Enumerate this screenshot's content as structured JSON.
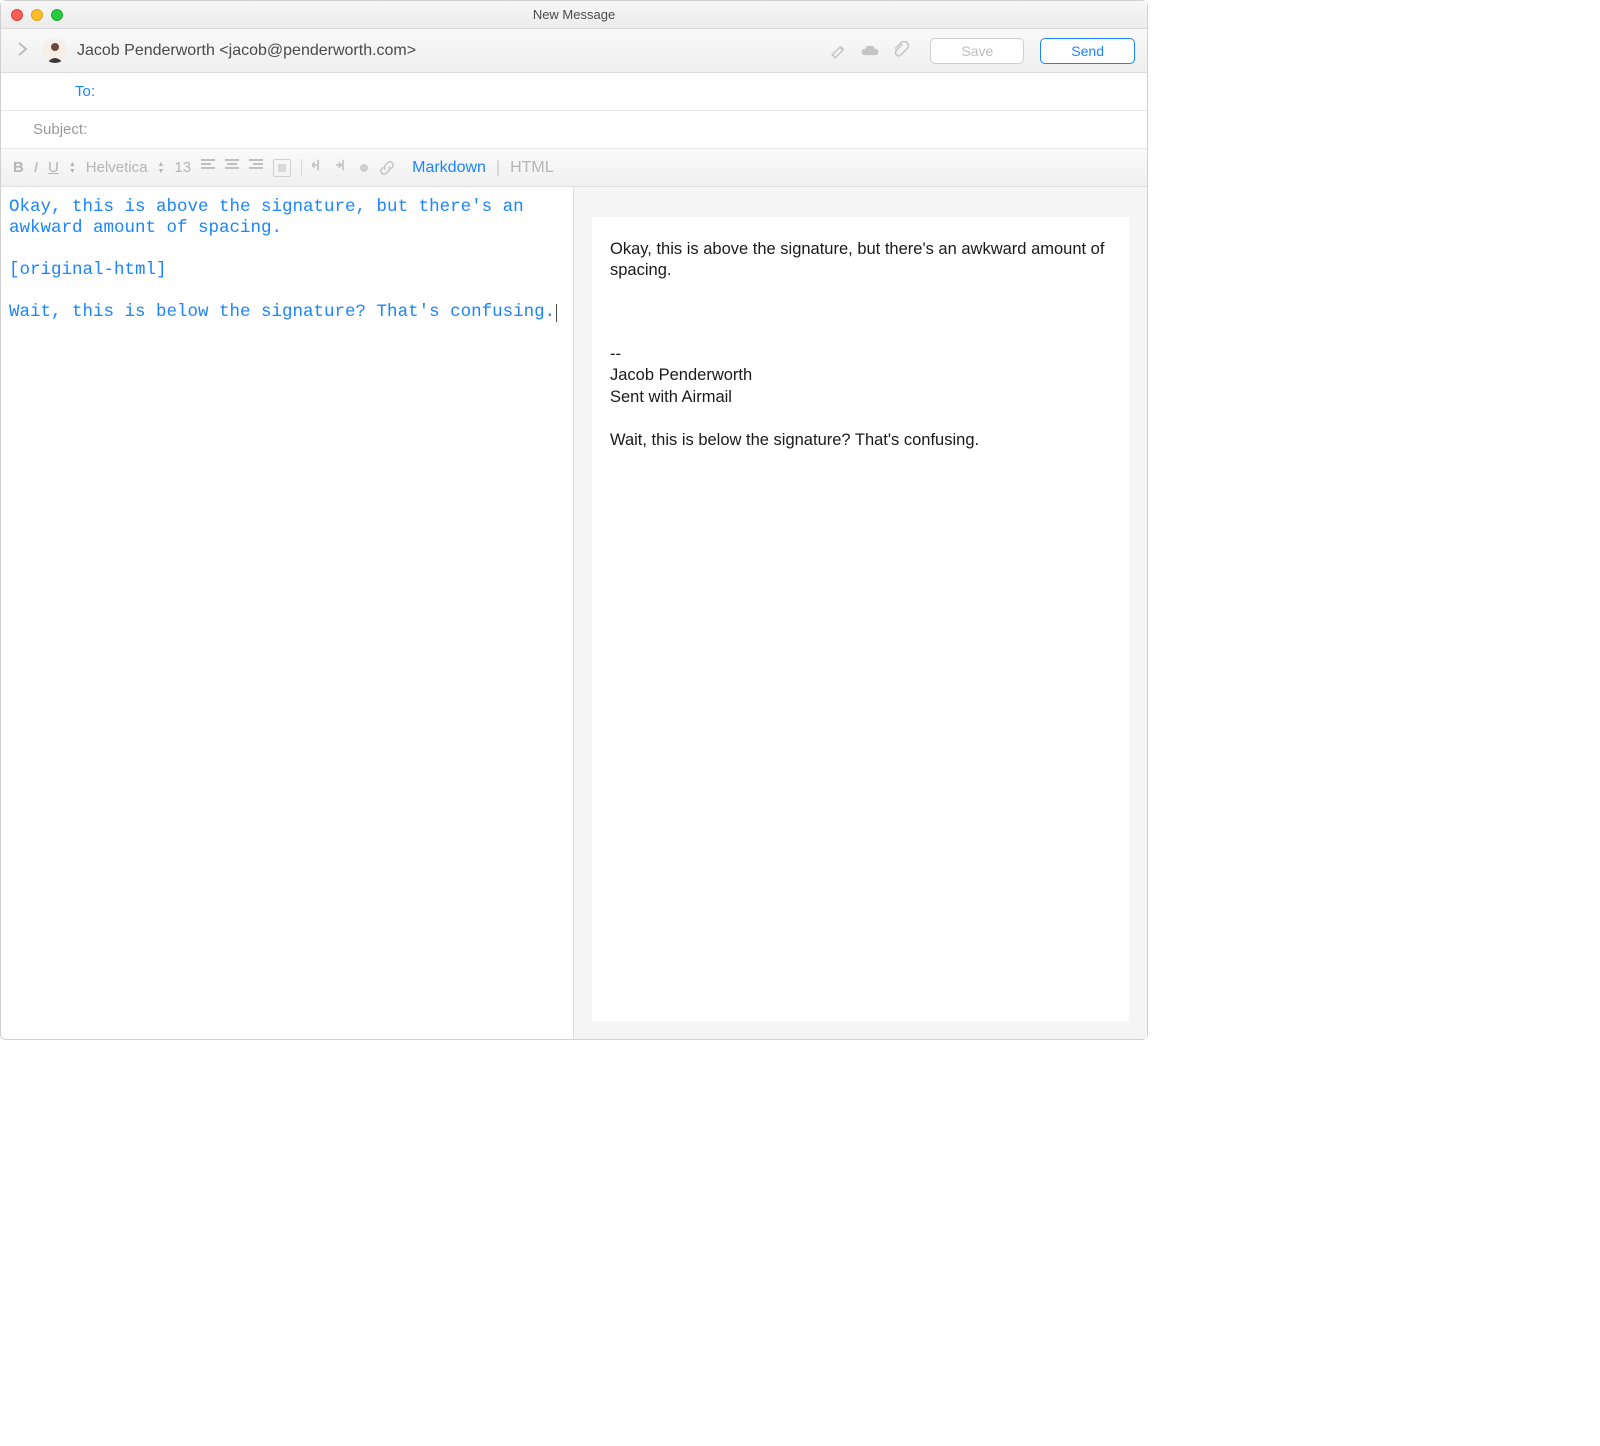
{
  "window": {
    "title": "New Message"
  },
  "header": {
    "from": "Jacob Penderworth <jacob@penderworth.com>",
    "save_label": "Save",
    "send_label": "Send"
  },
  "fields": {
    "to_label": "To:",
    "subject_label": "Subject:"
  },
  "toolbar": {
    "bold": "B",
    "italic": "I",
    "underline": "U",
    "font": "Helvetica",
    "size": "13",
    "markdown": "Markdown",
    "html": "HTML"
  },
  "editor": {
    "line1": "Okay, this is above the signature, but there's an awkward amount of spacing.",
    "line2": "[original-html]",
    "line3": "Wait, this is below the signature? That's confusing."
  },
  "preview": {
    "p1": "Okay, this is above the signature, but there's an awkward amount of spacing.",
    "sig1": "--",
    "sig2": "Jacob Penderworth",
    "sig3": "Sent with Airmail",
    "p2": "Wait, this is below the signature? That's confusing."
  }
}
